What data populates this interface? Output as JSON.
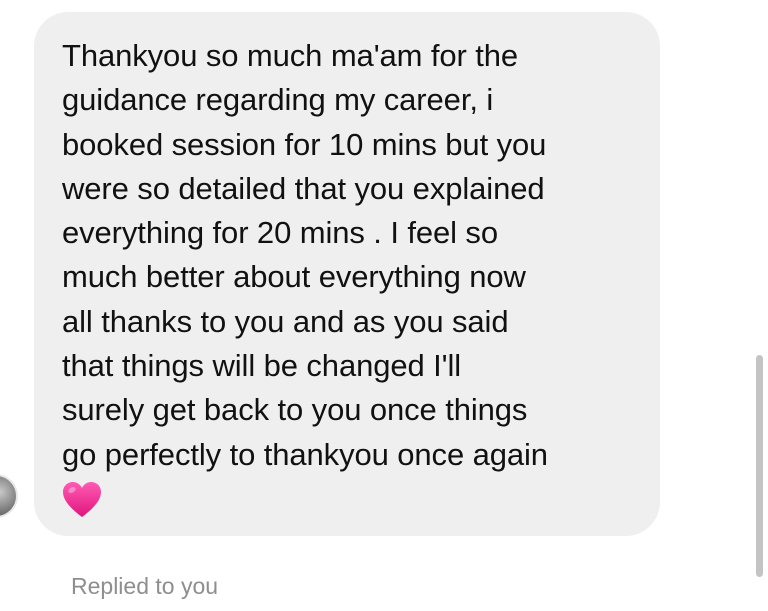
{
  "thread": {
    "message": {
      "text": "Thankyou so much ma'am for the\nguidance regarding my career,  i\nbooked session for 10 mins but you\nwere so detailed that you explained\neverything for 20 mins . I feel so\nmuch better about everything now\nall thanks to you and as you said\nthat things will be changed I'll\nsurely get back to you once things\ngo perfectly to thankyou once again",
      "emoji_icon": "pink-heart-icon",
      "bubble_color": "#efefef",
      "heart_color": "#f0308f"
    },
    "reply_status": "Replied to you"
  }
}
